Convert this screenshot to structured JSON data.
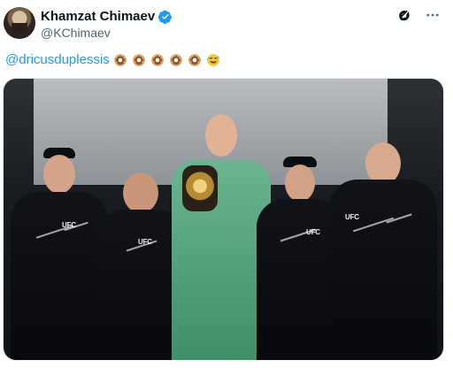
{
  "tweet": {
    "display_name": "Khamzat Chimaev",
    "handle": "@KChimaev",
    "mention": "@dricusduplessis",
    "emoji_sequence": [
      "doughnut",
      "doughnut",
      "doughnut",
      "doughnut",
      "doughnut",
      "rolling-on-the-floor-laughing"
    ]
  },
  "icons": {
    "verified": "verified-badge-icon",
    "grok": "grok-icon",
    "more": "more-options-icon",
    "doughnut": "doughnut-emoji",
    "laugh": "rolling-laughing-emoji"
  },
  "colors": {
    "accent": "#1d9bf0",
    "text": "#0f1419",
    "muted": "#536471",
    "media_dark": "#181c20",
    "suit_green": "#4d9c73"
  },
  "media": {
    "logo_text": "UFC"
  }
}
